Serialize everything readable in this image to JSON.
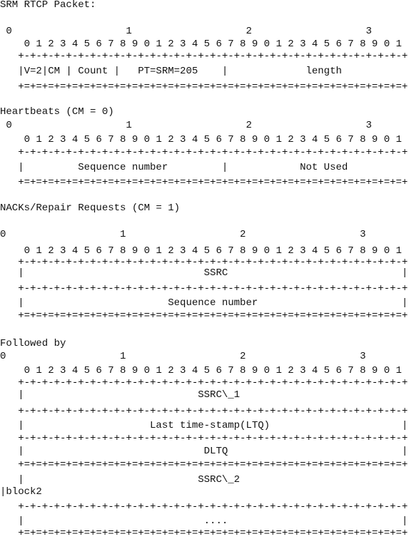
{
  "document": {
    "title": "SRM RTCP Packet:",
    "sections": [
      {
        "name": "srm-rtcp-packet",
        "lines": [
          "SRM RTCP Packet:",
          " 0                   1                   2                   3",
          "    0 1 2 3 4 5 6 7 8 9 0 1 2 3 4 5 6 7 8 9 0 1 2 3 4 5 6 7 8 9 0 1",
          "   +-+-+-+-+-+-+-+-+-+-+-+-+-+-+-+-+-+-+-+-+-+-+-+-+-+-+-+-+-+-+-+-+",
          "   |V=2|CM | Count |   PT=SRM=205    |             length            |",
          "   +=+=+=+=+=+=+=+=+=+=+=+=+=+=+=+=+=+=+=+=+=+=+=+=+=+=+=+=+=+=+=+=+"
        ]
      },
      {
        "name": "heartbeats",
        "lines": [
          "Heartbeats (CM = 0)",
          " 0                   1                   2                   3",
          "    0 1 2 3 4 5 6 7 8 9 0 1 2 3 4 5 6 7 8 9 0 1 2 3 4 5 6 7 8 9 0 1",
          "   +-+-+-+-+-+-+-+-+-+-+-+-+-+-+-+-+-+-+-+-+-+-+-+-+-+-+-+-+-+-+-+-+",
          "   |         Sequence number         |            Not Used           |",
          "   +=+=+=+=+=+=+=+=+=+=+=+=+=+=+=+=+=+=+=+=+=+=+=+=+=+=+=+=+=+=+=+=+"
        ]
      },
      {
        "name": "nacks-repair-requests",
        "lines": [
          "NACKs/Repair Requests (CM = 1)",
          "0                   1                   2                   3",
          "    0 1 2 3 4 5 6 7 8 9 0 1 2 3 4 5 6 7 8 9 0 1 2 3 4 5 6 7 8 9 0 1",
          "   +-+-+-+-+-+-+-+-+-+-+-+-+-+-+-+-+-+-+-+-+-+-+-+-+-+-+-+-+-+-+-+-+",
          "   |                              SSRC                             |",
          "   +-+-+-+-+-+-+-+-+-+-+-+-+-+-+-+-+-+-+-+-+-+-+-+-+-+-+-+-+-+-+-+-+",
          "   |                        Sequence number                        |",
          "   +=+=+=+=+=+=+=+=+=+=+=+=+=+=+=+=+=+=+=+=+=+=+=+=+=+=+=+=+=+=+=+=+"
        ]
      },
      {
        "name": "followed-by",
        "lines": [
          "Followed by",
          "0                   1                   2                   3",
          "    0 1 2 3 4 5 6 7 8 9 0 1 2 3 4 5 6 7 8 9 0 1 2 3 4 5 6 7 8 9 0 1",
          "   +-+-+-+-+-+-+-+-+-+-+-+-+-+-+-+-+-+-+-+-+-+-+-+-+-+-+-+-+-+-+-+-+",
          "   |                             SSRC\\_1                            |",
          "   +-+-+-+-+-+-+-+-+-+-+-+-+-+-+-+-+-+-+-+-+-+-+-+-+-+-+-+-+-+-+-+-+",
          "   |                     Last time-stamp(LTQ)                      |",
          "   +-+-+-+-+-+-+-+-+-+-+-+-+-+-+-+-+-+-+-+-+-+-+-+-+-+-+-+-+-+-+-+-+",
          "   |                              DLTQ                             |",
          "   +=+=+=+=+=+=+=+=+=+=+=+=+=+=+=+=+=+=+=+=+=+=+=+=+=+=+=+=+=+=+=+=+",
          "   |                             SSRC\\_2",
          "|block2",
          "   +-+-+-+-+-+-+-+-+-+-+-+-+-+-+-+-+-+-+-+-+-+-+-+-+-+-+-+-+-+-+-+-+",
          "   |                              ....                             |",
          "   +=+=+=+=+=+=+=+=+=+=+=+=+=+=+=+=+=+=+=+=+=+=+=+=+=+=+=+=+=+=+=+=+"
        ]
      }
    ]
  }
}
